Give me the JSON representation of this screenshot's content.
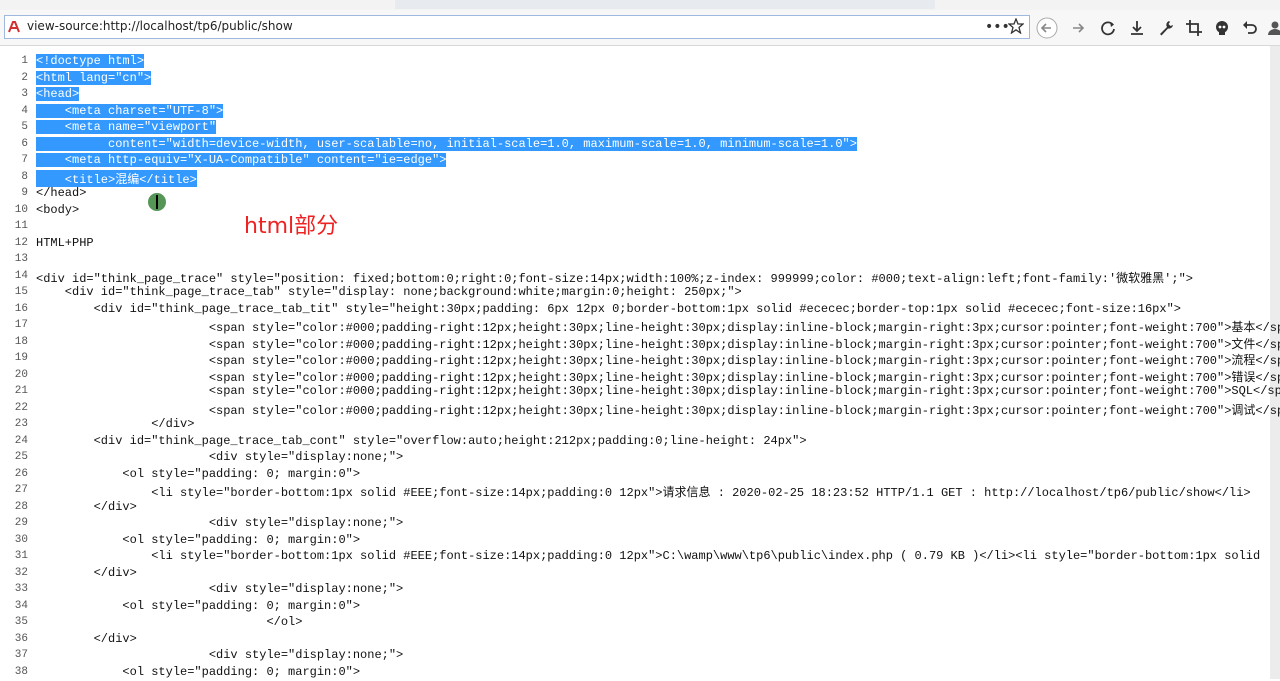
{
  "browser": {
    "url": "view-source:http://localhost/tp6/public/show",
    "more_label": "•••"
  },
  "annotation": "html部分",
  "lines": [
    {
      "n": "1",
      "text": "<!doctype html>",
      "sel": true
    },
    {
      "n": "2",
      "text": "<html lang=\"cn\">",
      "sel": true
    },
    {
      "n": "3",
      "text": "<head>",
      "sel": true
    },
    {
      "n": "4",
      "text": "    <meta charset=\"UTF-8\">",
      "sel": true
    },
    {
      "n": "5",
      "text": "    <meta name=\"viewport\"",
      "sel": true
    },
    {
      "n": "6",
      "text": "          content=\"width=device-width, user-scalable=no, initial-scale=1.0, maximum-scale=1.0, minimum-scale=1.0\">",
      "sel": true
    },
    {
      "n": "7",
      "text": "    <meta http-equiv=\"X-UA-Compatible\" content=\"ie=edge\">",
      "sel": true
    },
    {
      "n": "8",
      "text": "    <title>混编</title>",
      "sel": true,
      "selto": 14
    },
    {
      "n": "9",
      "text": "</head>",
      "sel": false
    },
    {
      "n": "10",
      "text": "<body>",
      "sel": false
    },
    {
      "n": "11",
      "text": "",
      "sel": false
    },
    {
      "n": "12",
      "text": "HTML+PHP",
      "sel": false
    },
    {
      "n": "13",
      "text": "",
      "sel": false
    },
    {
      "n": "14",
      "text": "<div id=\"think_page_trace\" style=\"position: fixed;bottom:0;right:0;font-size:14px;width:100%;z-index: 999999;color: #000;text-align:left;font-family:'微软雅黑';\">",
      "sel": false
    },
    {
      "n": "15",
      "text": "    <div id=\"think_page_trace_tab\" style=\"display: none;background:white;margin:0;height: 250px;\">",
      "sel": false
    },
    {
      "n": "16",
      "text": "        <div id=\"think_page_trace_tab_tit\" style=\"height:30px;padding: 6px 12px 0;border-bottom:1px solid #ececec;border-top:1px solid #ececec;font-size:16px\">",
      "sel": false
    },
    {
      "n": "17",
      "text": "                        <span style=\"color:#000;padding-right:12px;height:30px;line-height:30px;display:inline-block;margin-right:3px;cursor:pointer;font-weight:700\">基本</sp",
      "sel": false
    },
    {
      "n": "18",
      "text": "                        <span style=\"color:#000;padding-right:12px;height:30px;line-height:30px;display:inline-block;margin-right:3px;cursor:pointer;font-weight:700\">文件</sp",
      "sel": false
    },
    {
      "n": "19",
      "text": "                        <span style=\"color:#000;padding-right:12px;height:30px;line-height:30px;display:inline-block;margin-right:3px;cursor:pointer;font-weight:700\">流程</sp",
      "sel": false
    },
    {
      "n": "20",
      "text": "                        <span style=\"color:#000;padding-right:12px;height:30px;line-height:30px;display:inline-block;margin-right:3px;cursor:pointer;font-weight:700\">错误</sp",
      "sel": false
    },
    {
      "n": "21",
      "text": "                        <span style=\"color:#000;padding-right:12px;height:30px;line-height:30px;display:inline-block;margin-right:3px;cursor:pointer;font-weight:700\">SQL</spa",
      "sel": false
    },
    {
      "n": "22",
      "text": "                        <span style=\"color:#000;padding-right:12px;height:30px;line-height:30px;display:inline-block;margin-right:3px;cursor:pointer;font-weight:700\">调试</sp",
      "sel": false
    },
    {
      "n": "23",
      "text": "                </div>",
      "sel": false
    },
    {
      "n": "24",
      "text": "        <div id=\"think_page_trace_tab_cont\" style=\"overflow:auto;height:212px;padding:0;line-height: 24px\">",
      "sel": false
    },
    {
      "n": "25",
      "text": "                        <div style=\"display:none;\">",
      "sel": false
    },
    {
      "n": "26",
      "text": "            <ol style=\"padding: 0; margin:0\">",
      "sel": false
    },
    {
      "n": "27",
      "text": "                <li style=\"border-bottom:1px solid #EEE;font-size:14px;padding:0 12px\">请求信息 : 2020-02-25 18:23:52 HTTP/1.1 GET : http://localhost/tp6/public/show</li>",
      "sel": false
    },
    {
      "n": "28",
      "text": "        </div>",
      "sel": false
    },
    {
      "n": "29",
      "text": "                        <div style=\"display:none;\">",
      "sel": false
    },
    {
      "n": "30",
      "text": "            <ol style=\"padding: 0; margin:0\">",
      "sel": false
    },
    {
      "n": "31",
      "text": "                <li style=\"border-bottom:1px solid #EEE;font-size:14px;padding:0 12px\">C:\\wamp\\www\\tp6\\public\\index.php ( 0.79 KB )</li><li style=\"border-bottom:1px solid",
      "sel": false
    },
    {
      "n": "32",
      "text": "        </div>",
      "sel": false
    },
    {
      "n": "33",
      "text": "                        <div style=\"display:none;\">",
      "sel": false
    },
    {
      "n": "34",
      "text": "            <ol style=\"padding: 0; margin:0\">",
      "sel": false
    },
    {
      "n": "35",
      "text": "                                </ol>",
      "sel": false
    },
    {
      "n": "36",
      "text": "        </div>",
      "sel": false
    },
    {
      "n": "37",
      "text": "                        <div style=\"display:none;\">",
      "sel": false
    },
    {
      "n": "38",
      "text": "            <ol style=\"padding: 0; margin:0\">",
      "sel": false
    }
  ]
}
